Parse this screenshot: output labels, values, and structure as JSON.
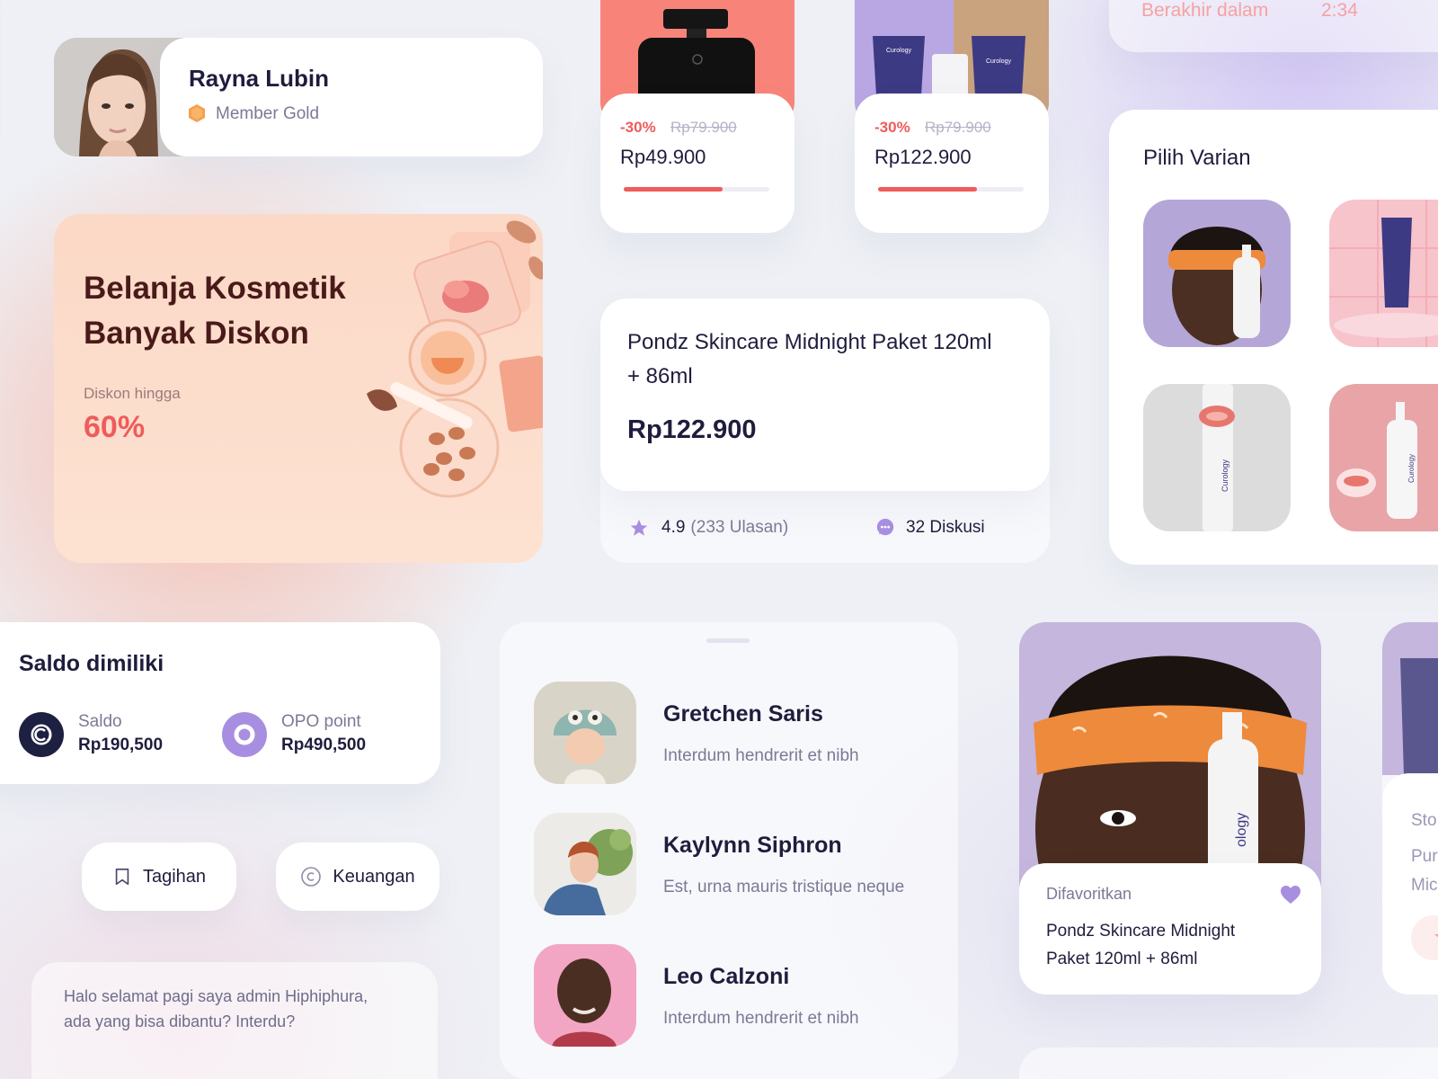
{
  "profile": {
    "name": "Rayna Lubin",
    "level": "Member Gold"
  },
  "promo": {
    "title_line1": "Belanja Kosmetik",
    "title_line2": "Banyak Diskon",
    "subtitle": "Diskon hingga",
    "value": "60%"
  },
  "products": [
    {
      "discount": "-30%",
      "old_price": "Rp79.900",
      "price": "Rp49.900",
      "stock_fraction": 0.68
    },
    {
      "discount": "-30%",
      "old_price": "Rp79.900",
      "price": "Rp122.900",
      "stock_fraction": 0.68
    }
  ],
  "detail": {
    "name": "Pondz Skincare Midnight Paket 120ml + 86ml",
    "price": "Rp122.900",
    "rating": "4.9",
    "reviews": "(233 Ulasan)",
    "discussion": "32 Diskusi"
  },
  "timer": {
    "label": "Berakhir dalam",
    "value": "2:34"
  },
  "variants": {
    "title": "Pilih Varian",
    "brand": "Curology"
  },
  "wallet": {
    "title": "Saldo dimiliki",
    "items": [
      {
        "label": "Saldo",
        "value": "Rp190,500"
      },
      {
        "label": "OPO point",
        "value": "Rp490,500"
      }
    ]
  },
  "actions": {
    "bill": "Tagihan",
    "finance": "Keuangan"
  },
  "chat": {
    "message": "Halo selamat pagi saya admin Hiphiphura, ada yang bisa dibantu? Interdu?"
  },
  "users": [
    {
      "name": "Gretchen Saris",
      "message": "Interdum hendrerit et  nibh"
    },
    {
      "name": "Kaylynn Siphron",
      "message": "Est, urna mauris tristique neque"
    },
    {
      "name": "Leo Calzoni",
      "message": "Interdum hendrerit et  nibh"
    }
  ],
  "favorite": {
    "label": "Difavoritkan",
    "name": "Pondz Skincare Midnight Paket 120ml + 86ml",
    "bottle_text": "ology"
  },
  "edge": {
    "lines": [
      "Sto",
      "Pur",
      "Mic"
    ]
  },
  "colors": {
    "accent_red": "#f05b5b",
    "accent_purple": "#a88ee0",
    "text_dark": "#1f1d3d",
    "text_muted": "#7b7a96",
    "coin_dark": "#1e2042"
  }
}
